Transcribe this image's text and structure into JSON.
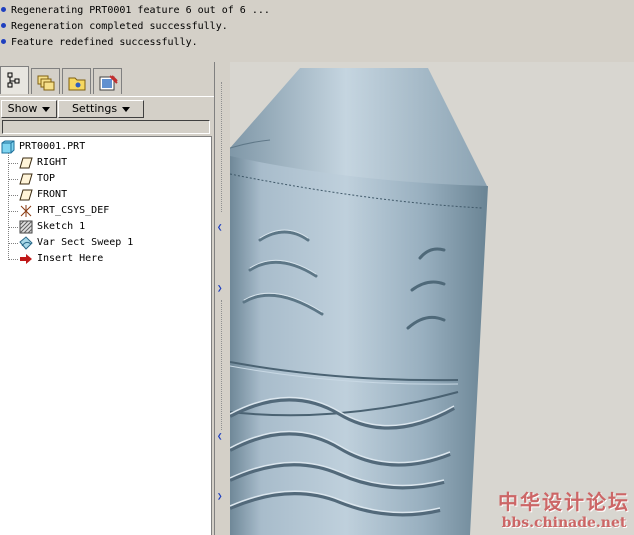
{
  "messages": [
    "Regenerating PRT0001 feature 6 out of 6 ...",
    "Regeneration completed successfully.",
    "Feature redefined successfully."
  ],
  "navigator": {
    "tabs": [
      "model-tree-icon",
      "layers-icon",
      "folder-browser-icon",
      "favorites-icon"
    ],
    "toolbar": {
      "show_label": "Show",
      "settings_label": "Settings"
    },
    "tree": {
      "root": "PRT0001.PRT",
      "items": [
        {
          "label": "RIGHT",
          "icon": "datum-plane-icon"
        },
        {
          "label": "TOP",
          "icon": "datum-plane-icon"
        },
        {
          "label": "FRONT",
          "icon": "datum-plane-icon"
        },
        {
          "label": "PRT_CSYS_DEF",
          "icon": "coordinate-system-icon"
        },
        {
          "label": "Sketch 1",
          "icon": "sketch-icon"
        },
        {
          "label": "Var Sect Sweep 1",
          "icon": "sweep-icon"
        },
        {
          "label": "Insert Here",
          "icon": "insert-arrow-icon"
        }
      ]
    }
  },
  "watermark": {
    "title": "中华设计论坛",
    "url": "bbs.chinade.net"
  },
  "colors": {
    "bullet": "#1f3fbf",
    "model_surface": "#9fb4c4",
    "watermark": "#cc6666"
  }
}
